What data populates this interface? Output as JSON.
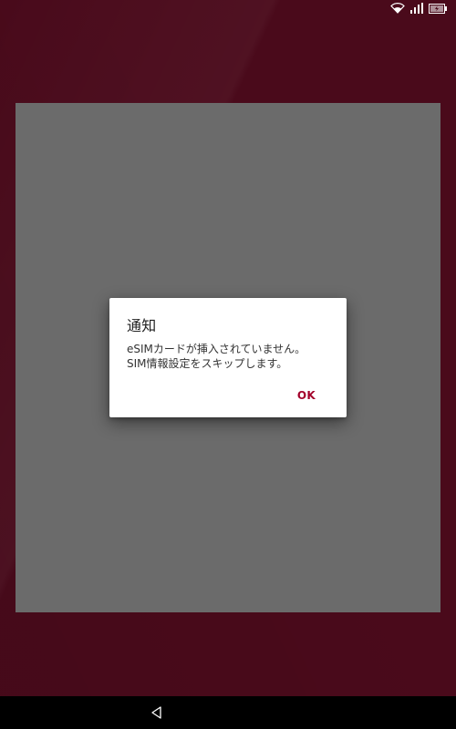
{
  "status_bar": {
    "icons": [
      "wifi-icon",
      "signal-icon",
      "battery-icon"
    ]
  },
  "dialog": {
    "title": "通知",
    "message_line1": "eSIMカードが挿入されていません。",
    "message_line2": "SIM情報設定をスキップします。",
    "ok_label": "OK"
  },
  "navigation": {
    "icons": [
      "back-icon"
    ]
  },
  "colors": {
    "background": "#4a0a1b",
    "panel": "#6b6b6b",
    "accent": "#a3002b",
    "nav_bar": "#000000"
  }
}
